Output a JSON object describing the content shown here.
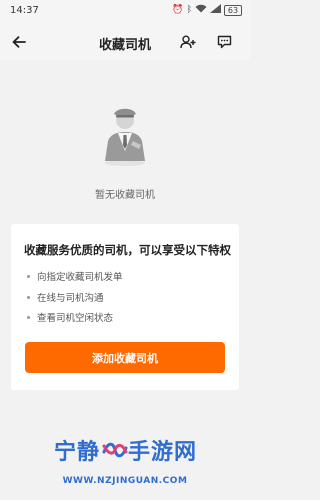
{
  "status_bar": {
    "time": "14:37",
    "battery": "63"
  },
  "header": {
    "title": "收藏司机"
  },
  "empty_state": {
    "message": "暂无收藏司机"
  },
  "benefits_card": {
    "title": "收藏服务优质的司机，可以享受以下特权",
    "items": [
      "向指定收藏司机发单",
      "在线与司机沟通",
      "查看司机空闲状态"
    ],
    "button_label": "添加收藏司机"
  },
  "watermark": {
    "left_text": "宁静",
    "right_text": "手游网",
    "url": "WWW.NZJINGUAN.COM"
  },
  "colors": {
    "accent": "#ff6a00",
    "watermark": "#2f6dd0",
    "background": "#f2f2f2"
  }
}
